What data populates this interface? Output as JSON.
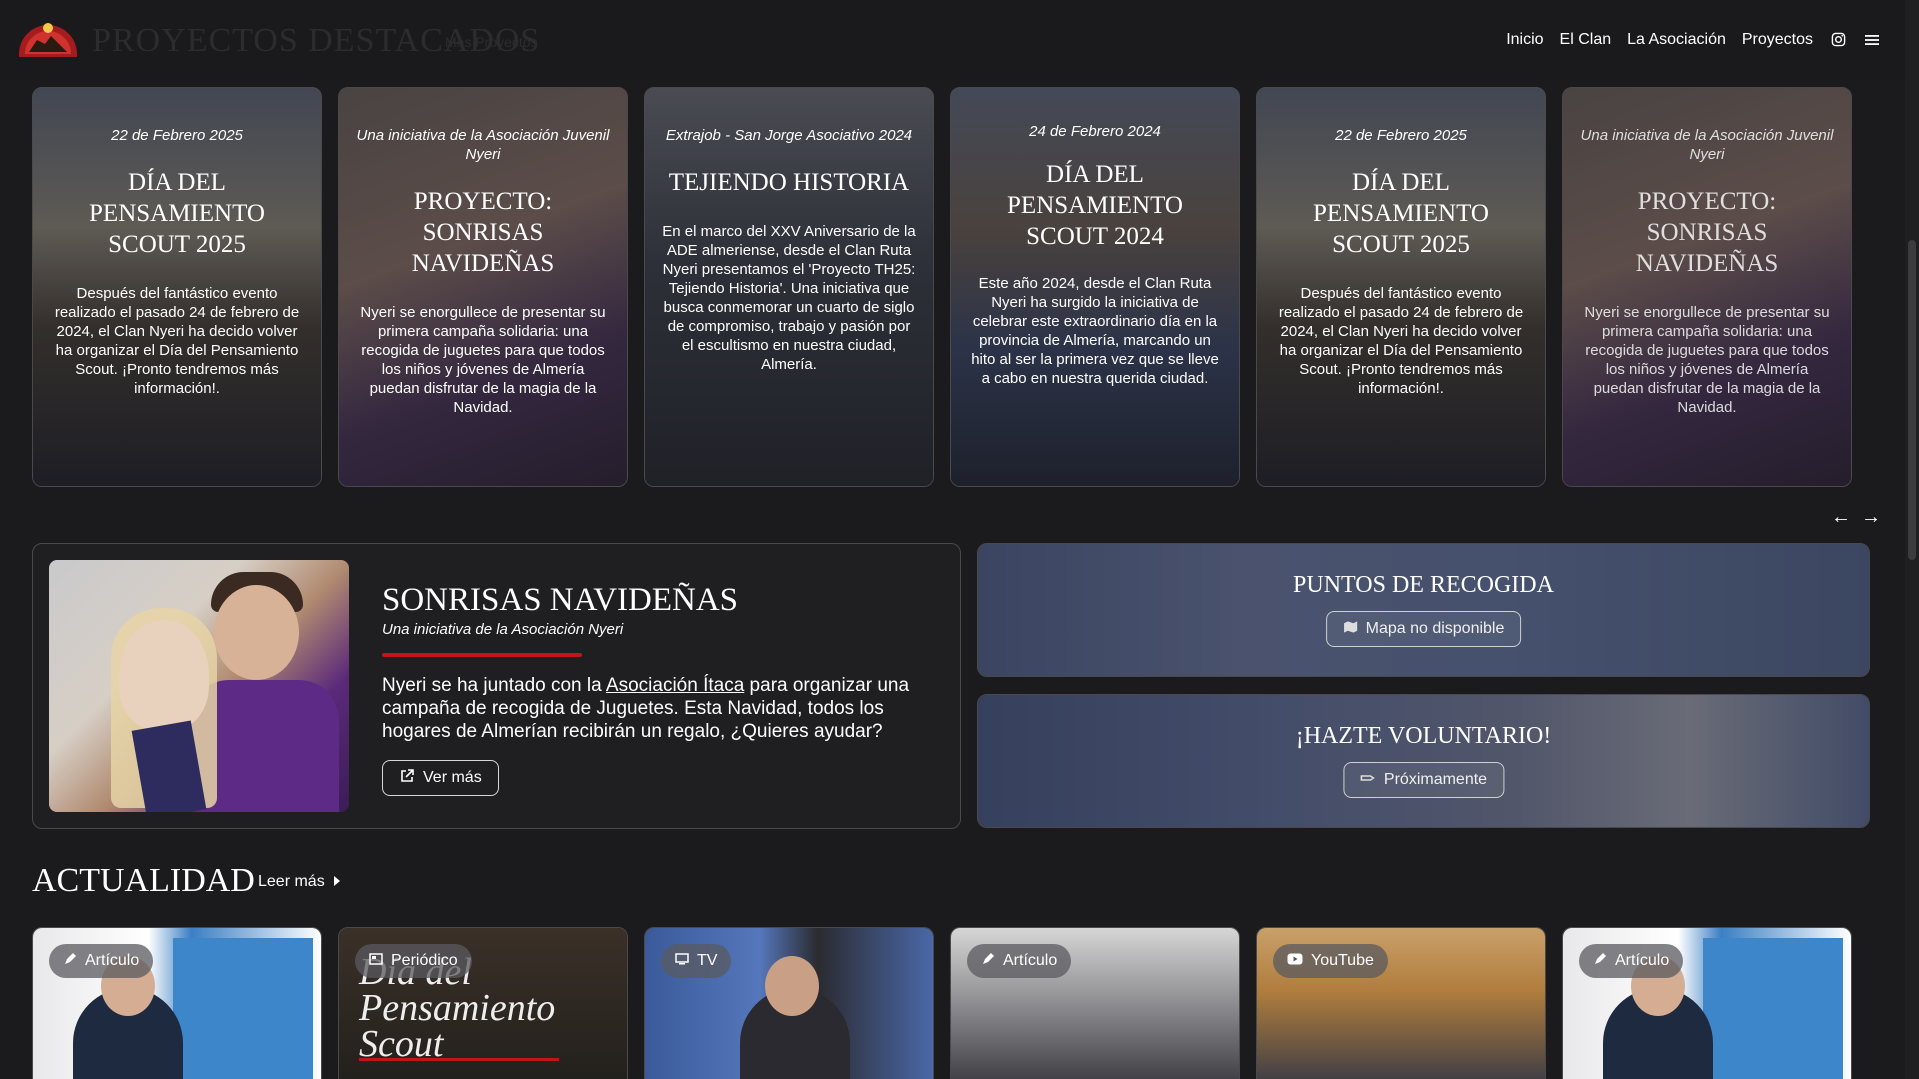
{
  "nav": {
    "ghost_title": "PROYECTOS DESTACADOS",
    "ghost_sub": "Más Proyectos",
    "links": [
      "Inicio",
      "El Clan",
      "La Asociación",
      "Proyectos"
    ],
    "icons": [
      "instagram-icon",
      "menu-icon"
    ]
  },
  "cards": [
    {
      "date": "22 de Febrero 2025",
      "title": "DÍA DEL PENSAMIENTO SCOUT 2025",
      "body": "Después del fantástico evento realizado el pasado 24 de febrero de 2024, el Clan Nyeri ha decido volver ha organizar el Día del Pensamiento Scout. ¡Pronto tendremos más información!."
    },
    {
      "date": "Una iniciativa de la Asociación Juvenil Nyeri",
      "title": "PROYECTO: SONRISAS NAVIDEÑAS",
      "body": "Nyeri se enorgullece de presentar su primera campaña solidaria: una recogida de juguetes para que todos los niños y jóvenes de Almería puedan disfrutar de la magia de la Navidad."
    },
    {
      "date": "Extrajob - San Jorge Asociativo 2024",
      "title": "TEJIENDO HISTORIA",
      "body": "En el marco del XXV Aniversario de la ADE almeriense, desde el Clan Ruta Nyeri presentamos el 'Proyecto TH25: Tejiendo Historia'. Una iniciativa que busca conmemorar un cuarto de siglo de compromiso, trabajo y pasión por el escultismo en nuestra ciudad, Almería."
    },
    {
      "date": "24 de Febrero 2024",
      "title": "DÍA DEL PENSAMIENTO SCOUT 2024",
      "body": "Este año 2024, desde el Clan Ruta Nyeri ha surgido la iniciativa de celebrar este extraordinario día en la provincia de Almería, marcando un hito al ser la primera vez que se lleve a cabo en nuestra querida ciudad."
    },
    {
      "date": "22 de Febrero 2025",
      "title": "DÍA DEL PENSAMIENTO SCOUT 2025",
      "body": "Después del fantástico evento realizado el pasado 24 de febrero de 2024, el Clan Nyeri ha decido volver ha organizar el Día del Pensamiento Scout. ¡Pronto tendremos más información!."
    },
    {
      "date": "Una iniciativa de la Asociación Juvenil Nyeri",
      "title": "PROYECTO: SONRISAS NAVIDEÑAS",
      "body": "Nyeri se enorgullece de presentar su primera campaña solidaria: una recogida de juguetes para que todos los niños y jóvenes de Almería puedan disfrutar de la magia de la Navidad."
    }
  ],
  "carousel": {
    "prev": "←",
    "next": "→"
  },
  "project": {
    "title": "SONRISAS NAVIDEÑAS",
    "subtitle": "Una iniciativa de la Asociación Nyeri",
    "text_before": "Nyeri se ha juntado con la ",
    "link": "Asociación Ítaca",
    "text_after": " para organizar una campaña de recogida de Juguetes. Esta Navidad, todos los hogares de Almerían recibirán un regalo, ¿Quieres ayudar?",
    "button": "Ver más"
  },
  "side_panels": [
    {
      "title": "PUNTOS DE RECOGIDA",
      "button": "Mapa no disponible",
      "icon": "map-icon"
    },
    {
      "title": "¡HAZTE VOLUNTARIO!",
      "button": "Próximamente",
      "icon": "hands-icon"
    }
  ],
  "actualidad": {
    "title": "ACTUALIDAD",
    "more": "Leer más",
    "items": [
      {
        "badge": "Artículo",
        "icon": "pen-icon"
      },
      {
        "badge": "Periódico",
        "icon": "newspaper-icon",
        "image_text": "Día del Pensamiento Scout"
      },
      {
        "badge": "TV",
        "icon": "tv-icon"
      },
      {
        "badge": "Artículo",
        "icon": "pen-icon"
      },
      {
        "badge": "YouTube",
        "icon": "youtube-icon"
      },
      {
        "badge": "Artículo",
        "icon": "pen-icon"
      }
    ]
  },
  "colors": {
    "background": "#1b1b1d",
    "accent_red": "#c0161b",
    "border": "#4a4a4c"
  }
}
